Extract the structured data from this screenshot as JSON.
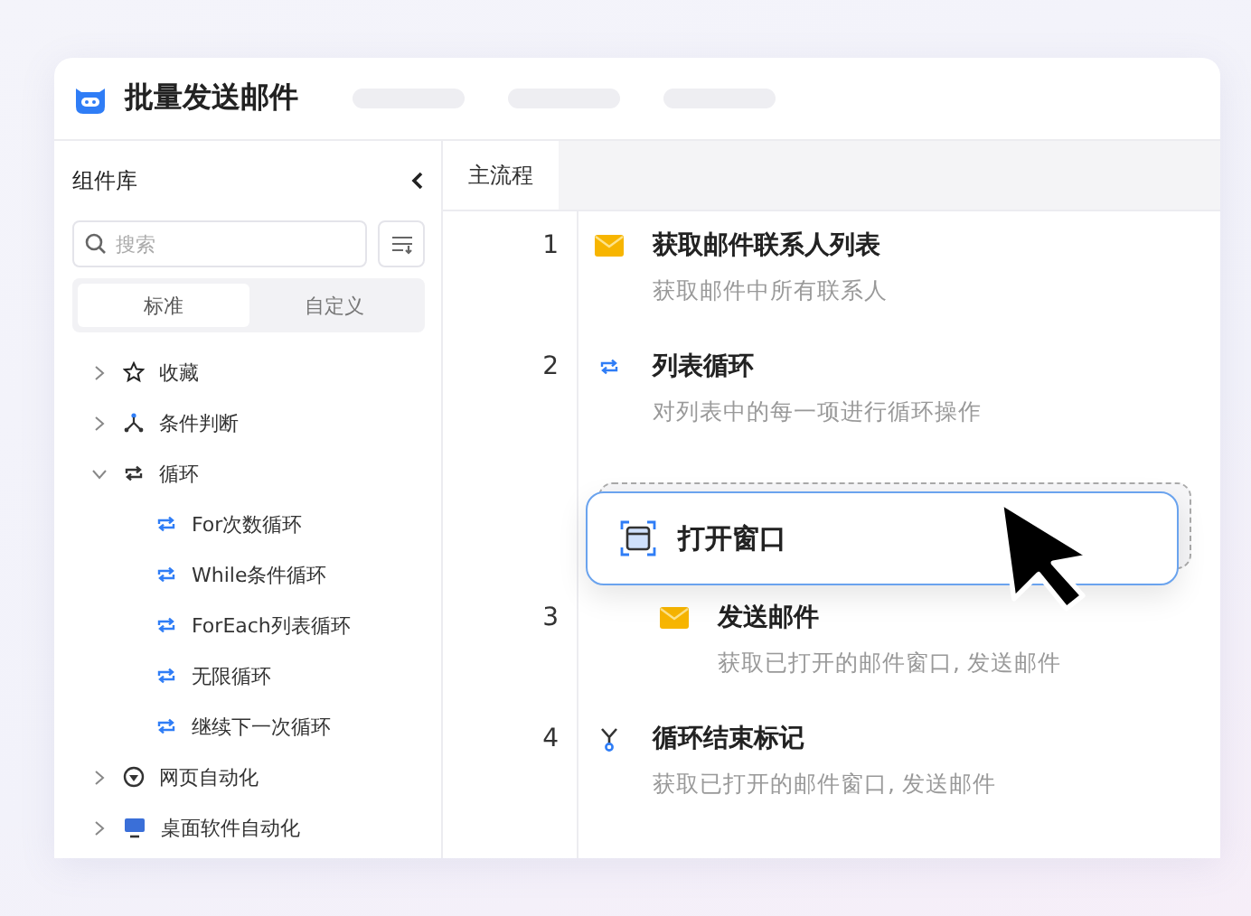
{
  "app": {
    "title": "批量发送邮件"
  },
  "sidebar": {
    "title": "组件库",
    "search": {
      "placeholder": "搜索"
    },
    "tabs": [
      {
        "label": "标准",
        "selected": true
      },
      {
        "label": "自定义",
        "selected": false
      }
    ],
    "tree": [
      {
        "label": "收藏",
        "kind": "star",
        "expanded": false
      },
      {
        "label": "条件判断",
        "kind": "branch",
        "expanded": false
      },
      {
        "label": "循环",
        "kind": "loop",
        "expanded": true,
        "children": [
          {
            "label": "For次数循环",
            "kind": "loop"
          },
          {
            "label": "While条件循环",
            "kind": "loop"
          },
          {
            "label": "ForEach列表循环",
            "kind": "loop"
          },
          {
            "label": "无限循环",
            "kind": "loop"
          },
          {
            "label": "继续下一次循环",
            "kind": "loop"
          }
        ]
      },
      {
        "label": "网页自动化",
        "kind": "globe",
        "expanded": false
      },
      {
        "label": "桌面软件自动化",
        "kind": "monitor",
        "expanded": false
      }
    ]
  },
  "main": {
    "tabs": [
      {
        "label": "主流程",
        "selected": true
      }
    ],
    "steps": [
      {
        "number": "1",
        "kind": "mail",
        "title": "获取邮件联系人列表",
        "description": "获取邮件中所有联系人"
      },
      {
        "number": "2",
        "kind": "loop",
        "title": "列表循环",
        "description": "对列表中的每一项进行循环操作",
        "children": [
          {
            "number": "3",
            "kind": "mail",
            "title": "发送邮件",
            "description": "获取已打开的邮件窗口, 发送邮件"
          }
        ]
      },
      {
        "number": "4",
        "kind": "loop-end",
        "title": "循环结束标记",
        "description": "获取已打开的邮件窗口, 发送邮件"
      }
    ],
    "dragged": {
      "kind": "window",
      "label": "打开窗口"
    }
  }
}
